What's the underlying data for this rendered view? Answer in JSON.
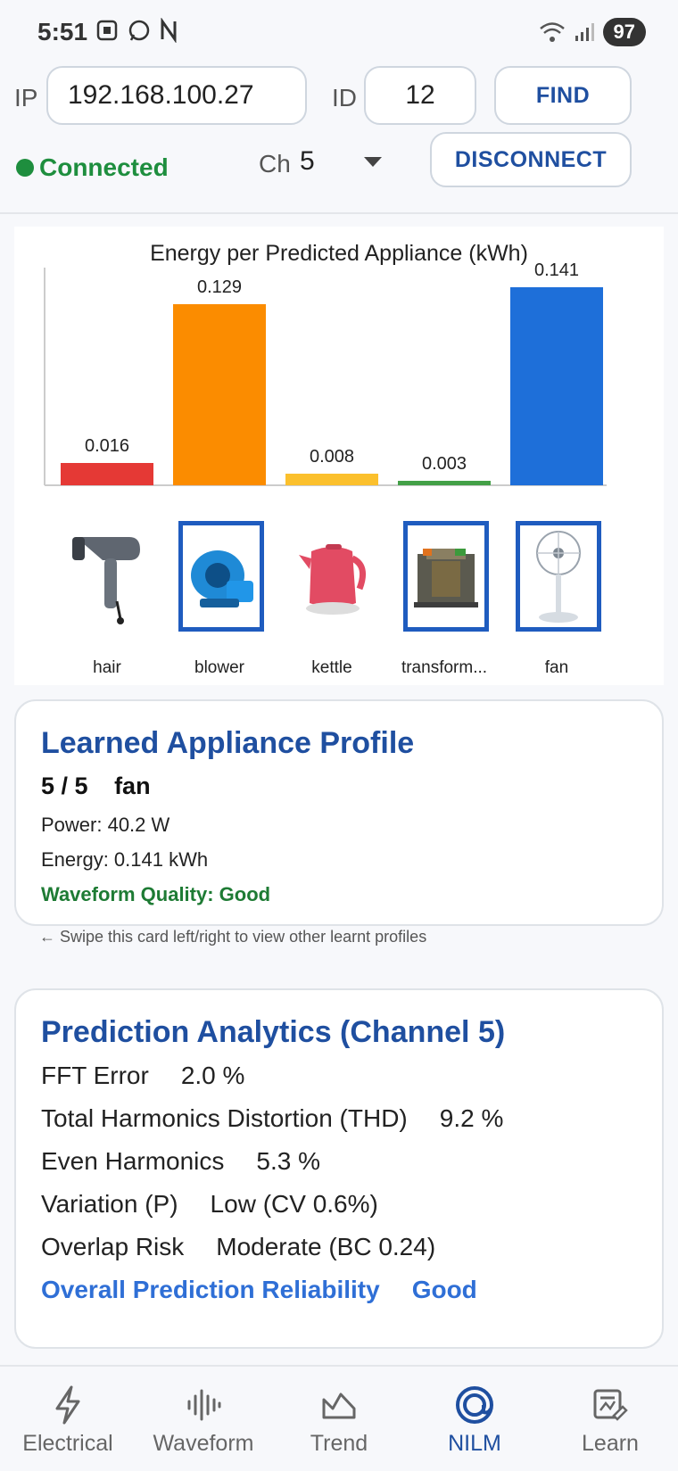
{
  "status_bar": {
    "time": "5:51",
    "battery": "97"
  },
  "connection": {
    "ip_label": "IP",
    "ip_value": "192.168.100.27",
    "id_label": "ID",
    "id_value": "12",
    "find_label": "FIND",
    "status": "Connected",
    "ch_label": "Ch",
    "ch_value": "5",
    "disconnect_label": "DISCONNECT"
  },
  "chart_data": {
    "type": "bar",
    "title": "Energy per Predicted Appliance (kWh)",
    "categories": [
      "hair",
      "blower",
      "kettle",
      "transform...",
      "fan"
    ],
    "values": [
      0.016,
      0.129,
      0.008,
      0.003,
      0.141
    ],
    "value_labels": [
      "0.016",
      "0.129",
      "0.008",
      "0.003",
      "0.141"
    ],
    "colors": [
      "#e53935",
      "#fb8c00",
      "#fbc02d",
      "#43a047",
      "#1e6fd9"
    ],
    "selected": [
      false,
      true,
      false,
      true,
      true
    ],
    "ylim": [
      0,
      0.155
    ],
    "xlabel": "",
    "ylabel": "",
    "grid": false
  },
  "profile": {
    "title": "Learned Appliance Profile",
    "counter": "5 / 5",
    "name": "fan",
    "power": "Power: 40.2 W",
    "energy": "Energy: 0.141 kWh",
    "quality": "Waveform Quality: Good",
    "hint": "← Swipe this card left/right to view other learnt profiles"
  },
  "analytics": {
    "title": "Prediction Analytics (Channel 5)",
    "rows": [
      {
        "label": "FFT Error",
        "value": "2.0 %"
      },
      {
        "label": "Total Harmonics Distortion (THD)",
        "value": "9.2 %"
      },
      {
        "label": "Even Harmonics",
        "value": "5.3 %"
      },
      {
        "label": "Variation (P)",
        "value": "Low (CV 0.6%)"
      },
      {
        "label": "Overlap Risk",
        "value": "Moderate (BC 0.24)"
      }
    ],
    "overall_label": "Overall Prediction Reliability",
    "overall_value": "Good"
  },
  "nav": {
    "items": [
      {
        "label": "Electrical",
        "icon": "bolt-icon"
      },
      {
        "label": "Waveform",
        "icon": "waveform-icon"
      },
      {
        "label": "Trend",
        "icon": "trend-icon"
      },
      {
        "label": "NILM",
        "icon": "nilm-icon"
      },
      {
        "label": "Learn",
        "icon": "learn-icon"
      }
    ],
    "active": "NILM"
  }
}
